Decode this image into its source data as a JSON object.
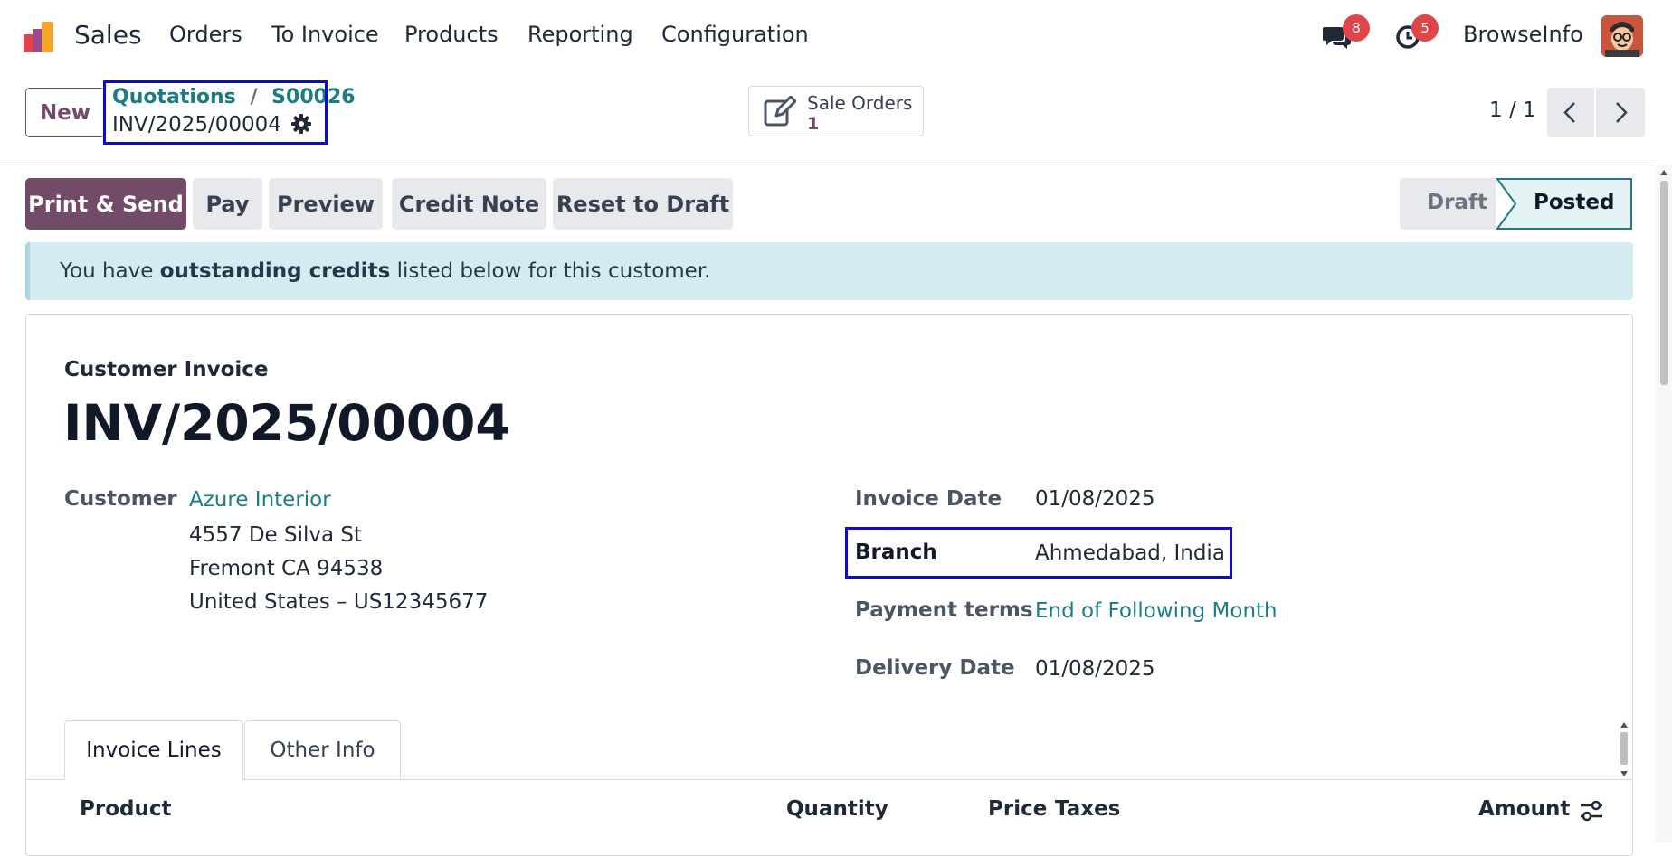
{
  "navbar": {
    "app_name": "Sales",
    "menu": [
      "Orders",
      "To Invoice",
      "Products",
      "Reporting",
      "Configuration"
    ],
    "messages_count": "8",
    "activities_count": "5",
    "user_name": "BrowseInfo",
    "icons": {
      "messages": "chat-bubbles-icon",
      "activities": "clock-icon"
    }
  },
  "control": {
    "new_label": "New",
    "breadcrumb_parent": "Quotations",
    "breadcrumb_sep": "/",
    "breadcrumb_child": "S00026",
    "record_name": "INV/2025/00004",
    "smart_button_label": "Sale Orders",
    "smart_button_count": "1",
    "pager": "1 / 1"
  },
  "actions": {
    "print_send": "Print & Send",
    "pay": "Pay",
    "preview": "Preview",
    "credit_note": "Credit Note",
    "reset_draft": "Reset to Draft"
  },
  "statusbar": {
    "draft": "Draft",
    "posted": "Posted",
    "active": "posted"
  },
  "alert": {
    "prefix": "You have ",
    "bold": "outstanding credits",
    "suffix": " listed below for this customer."
  },
  "form": {
    "doc_type": "Customer Invoice",
    "number": "INV/2025/00004",
    "customer_label": "Customer",
    "customer_name": "Azure Interior",
    "address_line1": "4557 De Silva St",
    "address_line2": "Fremont CA 94538",
    "address_line3": "United States – US12345677",
    "invoice_date_label": "Invoice Date",
    "invoice_date": "01/08/2025",
    "branch_label": "Branch",
    "branch": "Ahmedabad, India",
    "payment_terms_label": "Payment terms",
    "payment_terms": "End of Following Month",
    "delivery_date_label": "Delivery Date",
    "delivery_date": "01/08/2025"
  },
  "tabs": [
    "Invoice Lines",
    "Other Info"
  ],
  "table_headers": {
    "product": "Product",
    "quantity": "Quantity",
    "price": "Price",
    "taxes": "Taxes",
    "amount": "Amount"
  },
  "colors": {
    "primary": "#714b67",
    "link": "#1c7b83",
    "highlight": "#0a0ad4",
    "alert_bg": "#d4ebf2"
  }
}
